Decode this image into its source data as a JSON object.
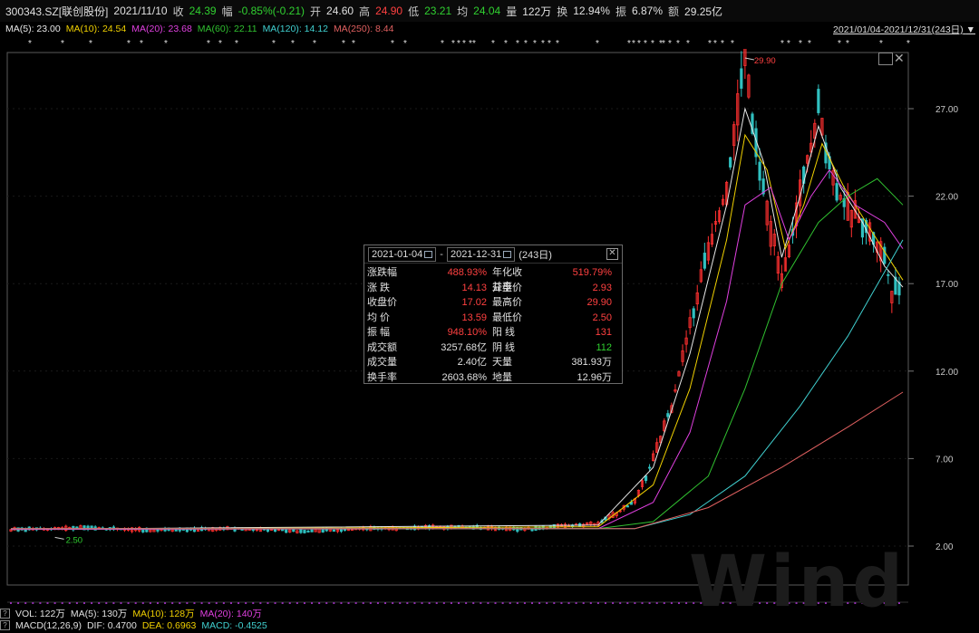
{
  "quote": {
    "code": "300343.SZ[联创股份]",
    "date": "2021/11/10",
    "close_label": "收",
    "close": "24.39",
    "change_label": "幅",
    "change": "-0.85%(-0.21)",
    "open_label": "开",
    "open": "24.60",
    "high_label": "高",
    "high": "24.90",
    "low_label": "低",
    "low": "23.21",
    "avg_label": "均",
    "avg": "24.04",
    "vol_label": "量",
    "vol": "122万",
    "turnover_label": "换",
    "turnover": "12.94%",
    "amplitude_label": "振",
    "amplitude": "6.87%",
    "amount_label": "额",
    "amount": "29.25亿"
  },
  "ma_legend": [
    {
      "label": "MA(5): 23.00",
      "color": "#e8e8e8"
    },
    {
      "label": "MA(10): 24.54",
      "color": "#f0d000"
    },
    {
      "label": "MA(20): 23.68",
      "color": "#e040e0"
    },
    {
      "label": "MA(60): 22.11",
      "color": "#30c030"
    },
    {
      "label": "MA(120): 14.12",
      "color": "#40d0d0"
    },
    {
      "label": "MA(250): 8.44",
      "color": "#e06060"
    }
  ],
  "range_selector": "2021/01/04-2021/12/31(243日)",
  "popup": {
    "start_date": "2021-01-04",
    "sep": "-",
    "end_date": "2021-12-31",
    "days": "(243日)",
    "rows": [
      {
        "l1": "涨跌幅",
        "v1": "488.93%",
        "c1": "#ff4040",
        "l2": "年化收益率",
        "v2": "519.79%",
        "c2": "#ff4040"
      },
      {
        "l1": "涨  跌",
        "v1": "14.13",
        "c1": "#ff4040",
        "l2": "开盘价",
        "v2": "2.93",
        "c2": "#ff4040"
      },
      {
        "l1": "收盘价",
        "v1": "17.02",
        "c1": "#ff4040",
        "l2": "最高价",
        "v2": "29.90",
        "c2": "#ff4040"
      },
      {
        "l1": "均  价",
        "v1": "13.59",
        "c1": "#ff4040",
        "l2": "最低价",
        "v2": "2.50",
        "c2": "#ff4040"
      },
      {
        "l1": "振  幅",
        "v1": "948.10%",
        "c1": "#ff4040",
        "l2": "阳  线",
        "v2": "131",
        "c2": "#ff4040"
      },
      {
        "l1": "成交额",
        "v1": "3257.68亿",
        "c1": "#e0e0e0",
        "l2": "阴  线",
        "v2": "112",
        "c2": "#30d030"
      },
      {
        "l1": "成交量",
        "v1": "2.40亿",
        "c1": "#e0e0e0",
        "l2": "天量",
        "v2": "381.93万",
        "c2": "#e0e0e0"
      },
      {
        "l1": "换手率",
        "v1": "2603.68%",
        "c1": "#e0e0e0",
        "l2": "地量",
        "v2": "12.96万",
        "c2": "#e0e0e0"
      }
    ]
  },
  "volume_bar": {
    "q": "?",
    "items": [
      {
        "label": "VOL: 122万",
        "color": "#e0e0e0"
      },
      {
        "label": "MA(5): 130万",
        "color": "#e0e0e0"
      },
      {
        "label": "MA(10): 128万",
        "color": "#f0d000"
      },
      {
        "label": "MA(20): 140万",
        "color": "#e040e0"
      }
    ]
  },
  "macd_bar": {
    "q": "?",
    "items": [
      {
        "label": "MACD(12,26,9)",
        "color": "#e0e0e0"
      },
      {
        "label": "DIF: 0.4700",
        "color": "#e0e0e0"
      },
      {
        "label": "DEA: 0.6963",
        "color": "#f0d000"
      },
      {
        "label": "MACD: -0.4525",
        "color": "#40d0d0"
      }
    ]
  },
  "watermark": "Wind",
  "colors": {
    "up": "#ff3030",
    "down": "#30c0c0",
    "grid": "#4a4a4a"
  },
  "chart_data": {
    "type": "candlestick",
    "y_axis": {
      "ticks": [
        "27.00",
        "22.00",
        "17.00",
        "12.00",
        "7.00",
        "2.00"
      ],
      "values": [
        27,
        22,
        17,
        12,
        7,
        2
      ],
      "range": [
        2,
        29.9
      ]
    },
    "annotations": [
      {
        "label": "29.90",
        "kind": "high"
      },
      {
        "label": "2.50",
        "kind": "low"
      }
    ],
    "close_path": [
      [
        0,
        2.93
      ],
      [
        20,
        3.05
      ],
      [
        40,
        2.9
      ],
      [
        60,
        3.0
      ],
      [
        80,
        2.85
      ],
      [
        100,
        3.0
      ],
      [
        120,
        3.1
      ],
      [
        140,
        2.95
      ],
      [
        160,
        3.3
      ],
      [
        170,
        4.5
      ],
      [
        175,
        7.0
      ],
      [
        180,
        10.0
      ],
      [
        185,
        14.5
      ],
      [
        190,
        19.0
      ],
      [
        195,
        22.5
      ],
      [
        198,
        27.0
      ],
      [
        200,
        29.9
      ],
      [
        203,
        25.0
      ],
      [
        207,
        20.0
      ],
      [
        210,
        17.5
      ],
      [
        213,
        20.0
      ],
      [
        217,
        24.0
      ],
      [
        220,
        27.0
      ],
      [
        223,
        24.0
      ],
      [
        226,
        22.0
      ],
      [
        229,
        21.0
      ],
      [
        232,
        20.5
      ],
      [
        235,
        19.5
      ],
      [
        238,
        18.5
      ],
      [
        240,
        16.5
      ],
      [
        243,
        17.02
      ]
    ],
    "ma_lines": [
      {
        "name": "MA(5)",
        "color": "#e8e8e8",
        "points": [
          [
            0,
            2.95
          ],
          [
            160,
            3.2
          ],
          [
            175,
            6.5
          ],
          [
            185,
            13.0
          ],
          [
            195,
            21.5
          ],
          [
            200,
            27.0
          ],
          [
            205,
            24.0
          ],
          [
            210,
            18.5
          ],
          [
            215,
            22.0
          ],
          [
            220,
            26.0
          ],
          [
            226,
            22.5
          ],
          [
            232,
            20.5
          ],
          [
            238,
            18.0
          ],
          [
            243,
            16.8
          ]
        ]
      },
      {
        "name": "MA(10)",
        "color": "#f0d000",
        "points": [
          [
            0,
            2.95
          ],
          [
            160,
            3.1
          ],
          [
            175,
            5.5
          ],
          [
            185,
            11.0
          ],
          [
            195,
            19.5
          ],
          [
            200,
            25.5
          ],
          [
            206,
            23.5
          ],
          [
            211,
            19.0
          ],
          [
            216,
            21.5
          ],
          [
            221,
            25.0
          ],
          [
            227,
            22.5
          ],
          [
            233,
            20.5
          ],
          [
            239,
            18.5
          ],
          [
            243,
            17.2
          ]
        ]
      },
      {
        "name": "MA(20)",
        "color": "#e040e0",
        "points": [
          [
            0,
            2.95
          ],
          [
            160,
            3.0
          ],
          [
            175,
            4.5
          ],
          [
            185,
            8.5
          ],
          [
            195,
            16.0
          ],
          [
            200,
            21.5
          ],
          [
            207,
            22.5
          ],
          [
            212,
            19.5
          ],
          [
            218,
            22.0
          ],
          [
            223,
            23.5
          ],
          [
            230,
            21.5
          ],
          [
            238,
            20.5
          ],
          [
            243,
            19.0
          ]
        ]
      },
      {
        "name": "MA(60)",
        "color": "#30c030",
        "points": [
          [
            0,
            3.0
          ],
          [
            160,
            3.0
          ],
          [
            175,
            3.4
          ],
          [
            190,
            6.0
          ],
          [
            200,
            11.0
          ],
          [
            210,
            17.0
          ],
          [
            220,
            20.5
          ],
          [
            228,
            22.0
          ],
          [
            236,
            23.0
          ],
          [
            243,
            21.5
          ]
        ]
      },
      {
        "name": "MA(120)",
        "color": "#40d0d0",
        "points": [
          [
            0,
            3.0
          ],
          [
            170,
            3.0
          ],
          [
            185,
            3.8
          ],
          [
            200,
            6.0
          ],
          [
            215,
            10.0
          ],
          [
            228,
            14.0
          ],
          [
            243,
            19.5
          ]
        ]
      },
      {
        "name": "MA(250)",
        "color": "#e06060",
        "points": [
          [
            0,
            3.0
          ],
          [
            170,
            3.0
          ],
          [
            190,
            4.2
          ],
          [
            210,
            6.5
          ],
          [
            228,
            8.8
          ],
          [
            243,
            10.8
          ]
        ]
      }
    ]
  }
}
